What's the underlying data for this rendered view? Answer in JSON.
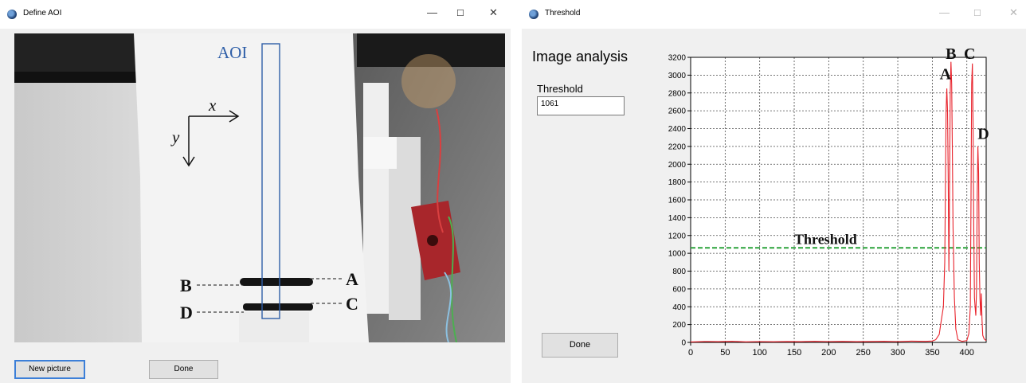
{
  "define_window": {
    "title": "Define AOI",
    "controls": {
      "minimize": "—",
      "maximize": "☐",
      "close": "✕"
    },
    "photo": {
      "aoi_label": "AOI",
      "axis_x_label": "x",
      "axis_y_label": "y",
      "marker_labels": {
        "a": "A",
        "b": "B",
        "c": "C",
        "d": "D"
      }
    },
    "buttons": {
      "new_picture": "New picture",
      "done": "Done"
    }
  },
  "threshold_window": {
    "title": "Threshold",
    "controls": {
      "minimize": "—",
      "maximize": "☐",
      "close": "✕"
    },
    "heading": "Image analysis",
    "threshold_label": "Threshold",
    "threshold_value": "1061",
    "done_label": "Done"
  },
  "chart_data": {
    "type": "line",
    "xlim": [
      0,
      428
    ],
    "ylim": [
      0,
      3200
    ],
    "x_ticks": [
      0,
      50,
      100,
      150,
      200,
      250,
      300,
      350,
      400
    ],
    "y_ticks": [
      0,
      200,
      400,
      600,
      800,
      1000,
      1200,
      1400,
      1600,
      1800,
      2000,
      2200,
      2400,
      2600,
      2800,
      3000,
      3200
    ],
    "grid": true,
    "threshold_value": 1061,
    "threshold_label": "Threshold",
    "colors": {
      "signal": "#e8222b",
      "threshold": "#2aa33a",
      "grid": "#4a4a4a"
    },
    "peak_labels": [
      {
        "label": "A",
        "x": 369,
        "y": 2900
      },
      {
        "label": "B",
        "x": 377,
        "y": 3130
      },
      {
        "label": "C",
        "x": 404,
        "y": 3130
      },
      {
        "label": "D",
        "x": 424,
        "y": 2230
      }
    ],
    "series": [
      {
        "points": [
          [
            0,
            5
          ],
          [
            20,
            10
          ],
          [
            40,
            8
          ],
          [
            60,
            12
          ],
          [
            80,
            6
          ],
          [
            100,
            9
          ],
          [
            120,
            7
          ],
          [
            140,
            10
          ],
          [
            160,
            8
          ],
          [
            180,
            12
          ],
          [
            200,
            9
          ],
          [
            220,
            11
          ],
          [
            240,
            8
          ],
          [
            260,
            10
          ],
          [
            280,
            12
          ],
          [
            300,
            9
          ],
          [
            320,
            14
          ],
          [
            340,
            12
          ],
          [
            350,
            15
          ],
          [
            355,
            30
          ],
          [
            360,
            90
          ],
          [
            363,
            250
          ],
          [
            366,
            400
          ],
          [
            368,
            900
          ],
          [
            369,
            1800
          ],
          [
            370,
            2600
          ],
          [
            371,
            2850
          ],
          [
            372,
            2600
          ],
          [
            373,
            1900
          ],
          [
            374,
            800
          ],
          [
            375,
            1800
          ],
          [
            376,
            2800
          ],
          [
            377,
            3150
          ],
          [
            378,
            2900
          ],
          [
            379,
            2200
          ],
          [
            380,
            1300
          ],
          [
            382,
            500
          ],
          [
            384,
            150
          ],
          [
            387,
            30
          ],
          [
            393,
            12
          ],
          [
            400,
            20
          ],
          [
            403,
            100
          ],
          [
            405,
            400
          ],
          [
            406,
            1500
          ],
          [
            407,
            2900
          ],
          [
            408,
            3130
          ],
          [
            409,
            2500
          ],
          [
            410,
            1300
          ],
          [
            411,
            500
          ],
          [
            412,
            400
          ],
          [
            413,
            300
          ],
          [
            414,
            600
          ],
          [
            415,
            1600
          ],
          [
            416,
            2200
          ],
          [
            417,
            1900
          ],
          [
            418,
            900
          ],
          [
            419,
            500
          ],
          [
            420,
            300
          ],
          [
            421,
            550
          ],
          [
            422,
            250
          ],
          [
            423,
            80
          ],
          [
            425,
            40
          ],
          [
            428,
            20
          ]
        ]
      }
    ]
  }
}
